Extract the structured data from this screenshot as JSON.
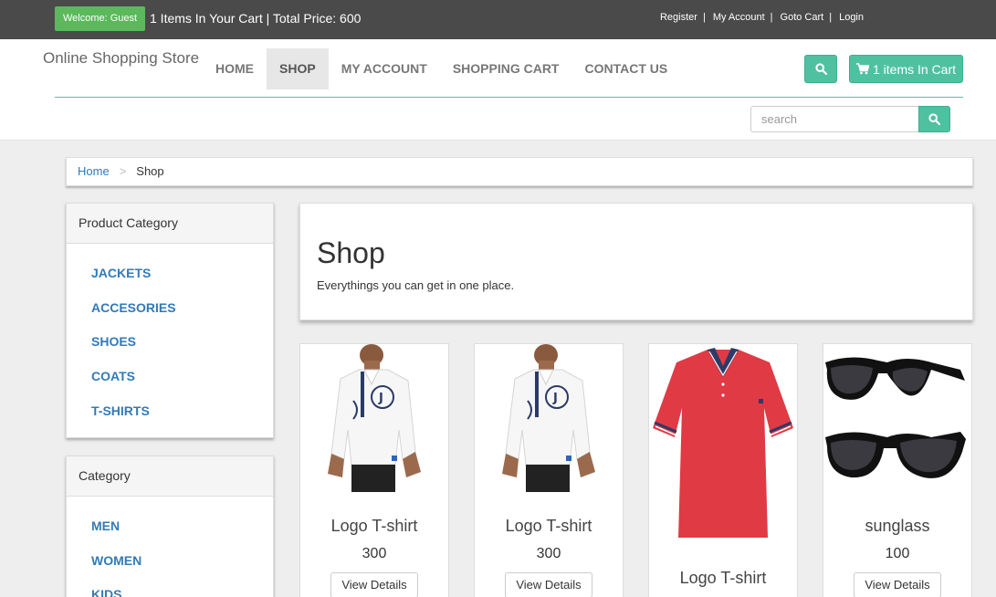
{
  "topbar": {
    "welcome": "Welcome: Guest",
    "cart_summary": "1 Items In Your Cart | Total Price: 600",
    "links": [
      "Register",
      "My Account",
      "Goto Cart",
      "Login"
    ],
    "separator": "|"
  },
  "header": {
    "brand": "Online Shopping Store",
    "nav": [
      "HOME",
      "SHOP",
      "MY ACCOUNT",
      "SHOPPING CART",
      "CONTACT US"
    ],
    "active_nav": "SHOP",
    "cart_button": "1 items In Cart",
    "search_placeholder": "search"
  },
  "breadcrumb": {
    "home": "Home",
    "separator": ">",
    "current": "Shop"
  },
  "sidebar": {
    "product_category": {
      "title": "Product Category",
      "items": [
        "JACKETS",
        "ACCESORIES",
        "SHOES",
        "COATS",
        "T-SHIRTS"
      ]
    },
    "category": {
      "title": "Category",
      "items": [
        "MEN",
        "WOMEN",
        "KIDS"
      ]
    }
  },
  "main": {
    "title": "Shop",
    "subtitle": "Everythings you can get in one place."
  },
  "products": [
    {
      "name": "Logo T-shirt",
      "price": "300",
      "button": "View Details",
      "image": "white-polo-model"
    },
    {
      "name": "Logo T-shirt",
      "price": "300",
      "button": "View Details",
      "image": "white-polo-model"
    },
    {
      "name": "Logo T-shirt",
      "price": "",
      "button": "",
      "image": "red-polo"
    },
    {
      "name": "sunglass",
      "price": "100",
      "button": "View Details",
      "image": "sunglasses"
    }
  ],
  "colors": {
    "topbar": "#4a4a4a",
    "welcome_badge": "#5cb85c",
    "accent": "#4fc1a1",
    "link": "#337ab7"
  },
  "icons": {
    "search": "search-icon",
    "cart": "shopping-cart-icon"
  }
}
